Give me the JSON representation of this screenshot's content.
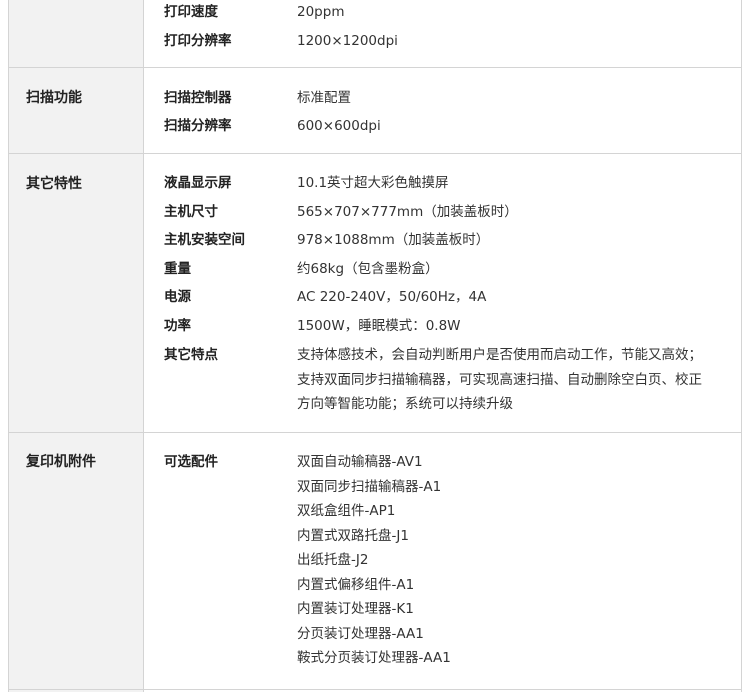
{
  "sections": [
    {
      "category": "",
      "rows": [
        {
          "key": "打印速度",
          "value": "20ppm"
        },
        {
          "key": "打印分辨率",
          "value": "1200×1200dpi"
        }
      ]
    },
    {
      "category": "扫描功能",
      "rows": [
        {
          "key": "扫描控制器",
          "value": "标准配置"
        },
        {
          "key": "扫描分辨率",
          "value": "600×600dpi"
        }
      ]
    },
    {
      "category": "其它特性",
      "rows": [
        {
          "key": "液晶显示屏",
          "value": "10.1英寸超大彩色触摸屏"
        },
        {
          "key": "主机尺寸",
          "value": "565×707×777mm（加装盖板时）"
        },
        {
          "key": "主机安装空间",
          "value": "978×1088mm（加装盖板时）"
        },
        {
          "key": "重量",
          "value": "约68kg（包含墨粉盒）"
        },
        {
          "key": "电源",
          "value": "AC 220-240V，50/60Hz，4A"
        },
        {
          "key": "功率",
          "value": "1500W，睡眠模式：0.8W"
        },
        {
          "key": "其它特点",
          "lines": [
            "支持体感技术，会自动判断用户是否使用而启动工作，节能又高效；",
            "支持双面同步扫描输稿器，可实现高速扫描、自动删除空白页、校正",
            "方向等智能功能；系统可以持续升级"
          ]
        }
      ]
    },
    {
      "category": "复印机附件",
      "rows": [
        {
          "key": "可选配件",
          "lines": [
            "双面自动输稿器-AV1",
            "双面同步扫描输稿器-A1",
            "双纸盒组件-AP1",
            "内置式双路托盘-J1",
            "出纸托盘-J2",
            "内置式偏移组件-A1",
            "内置装订处理器-K1",
            "分页装订处理器-AA1",
            "鞍式分页装订处理器-AA1"
          ]
        }
      ]
    }
  ]
}
